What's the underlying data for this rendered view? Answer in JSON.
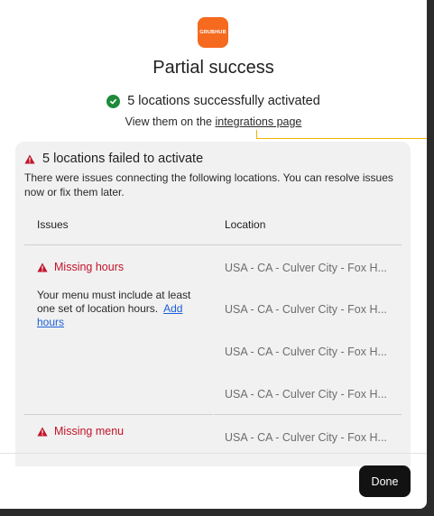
{
  "logo": {
    "text": "GRUBHUB"
  },
  "dialog": {
    "title": "Partial success",
    "success_text": "5 locations successfully activated",
    "view_prefix": "View them on the",
    "view_link": "integrations page"
  },
  "failures": {
    "title": "5 locations failed to activate",
    "description": "There were issues connecting the following locations. You can resolve issues now or fix them later.",
    "columns": [
      "Issues",
      "Location"
    ],
    "groups": [
      {
        "issue": "Missing hours",
        "description": "Your menu must include at least one set of location hours.",
        "action_link": "Add hours",
        "locations": [
          "USA - CA - Culver City - Fox H...",
          "USA - CA - Culver City - Fox H...",
          "USA - CA - Culver City - Fox H...",
          "USA - CA - Culver City - Fox H..."
        ]
      },
      {
        "issue": "Missing menu",
        "locations": [
          "USA - CA - Culver City - Fox H..."
        ]
      }
    ]
  },
  "footer": {
    "done_label": "Done"
  },
  "colors": {
    "brand": "#f56a1f",
    "success": "#1e8a3a",
    "error": "#c0142a",
    "link": "#1d5fd6",
    "callout_connector": "#f0b400"
  }
}
